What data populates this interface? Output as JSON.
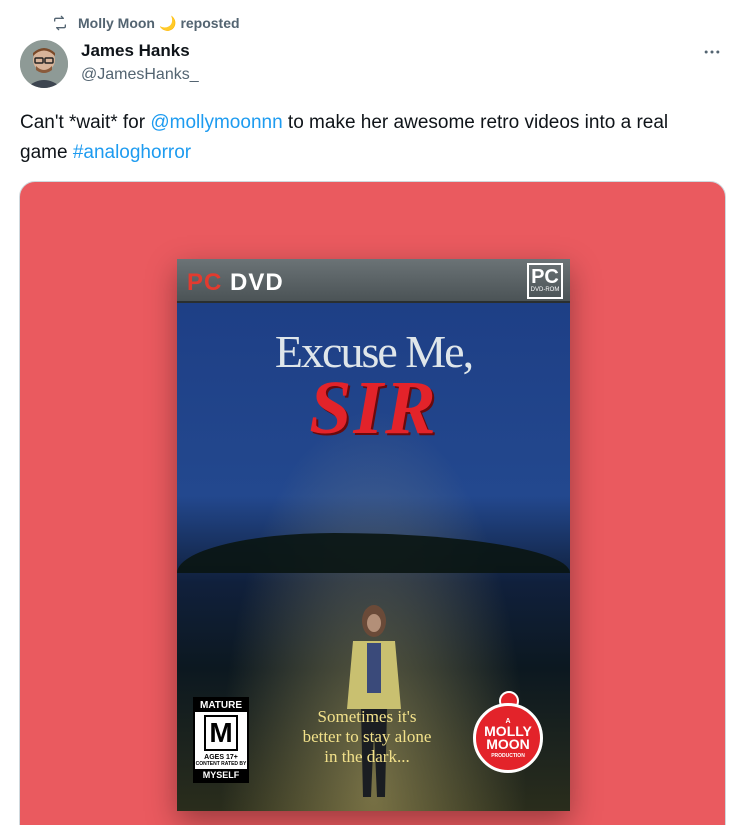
{
  "repost": {
    "icon": "repost-icon",
    "user": "Molly Moon",
    "emoji": "🌙",
    "label": "reposted"
  },
  "author": {
    "name": "James Hanks",
    "handle": "@JamesHanks_"
  },
  "tweet": {
    "part1": "Can't *wait* for ",
    "mention": "@mollymoonnn",
    "part2": " to make her awesome retro videos into a real game ",
    "hashtag": "#analoghorror"
  },
  "media": {
    "background": "#ea5a5f",
    "cover": {
      "pc": "PC",
      "dvd": "DVD",
      "badge_big": "PC",
      "badge_small": "DVD-ROM",
      "title_line1": "Excuse Me,",
      "title_line2": "SIR",
      "tagline": "Sometimes it's better to stay alone in the dark...",
      "rating": {
        "header": "MATURE",
        "letter": "M",
        "age": "AGES 17+",
        "note": "CONTENT RATED BY",
        "footer": "MYSELF"
      },
      "logo": {
        "prefix": "A",
        "name": "MOLLY MOON",
        "suffix": "PRODUCTION"
      }
    }
  },
  "colors": {
    "link": "#1d9bf0",
    "muted": "#536471",
    "title_red": "#e3232a"
  }
}
